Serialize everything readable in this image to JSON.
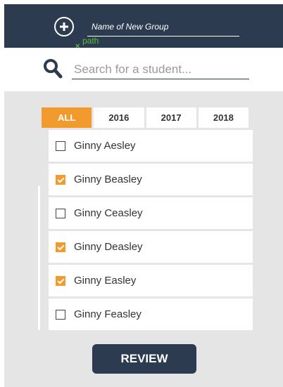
{
  "header": {
    "group_name_placeholder": "Name of New Group",
    "path_label": "path",
    "path_marker": "×"
  },
  "search": {
    "placeholder": "Search for a student..."
  },
  "tabs": [
    {
      "label": "ALL",
      "active": true
    },
    {
      "label": "2016",
      "active": false
    },
    {
      "label": "2017",
      "active": false
    },
    {
      "label": "2018",
      "active": false
    }
  ],
  "students": [
    {
      "name": "Ginny Aesley",
      "checked": false
    },
    {
      "name": "Ginny Beasley",
      "checked": true
    },
    {
      "name": "Ginny Ceasley",
      "checked": false
    },
    {
      "name": "Ginny Deasley",
      "checked": true
    },
    {
      "name": "Ginny Easley",
      "checked": true
    },
    {
      "name": "Ginny Feasley",
      "checked": false
    }
  ],
  "review_label": "REVIEW",
  "colors": {
    "header": "#2c3b4f",
    "accent": "#f29a2e",
    "background": "#e5e5e5",
    "path": "#5bbf3a"
  }
}
